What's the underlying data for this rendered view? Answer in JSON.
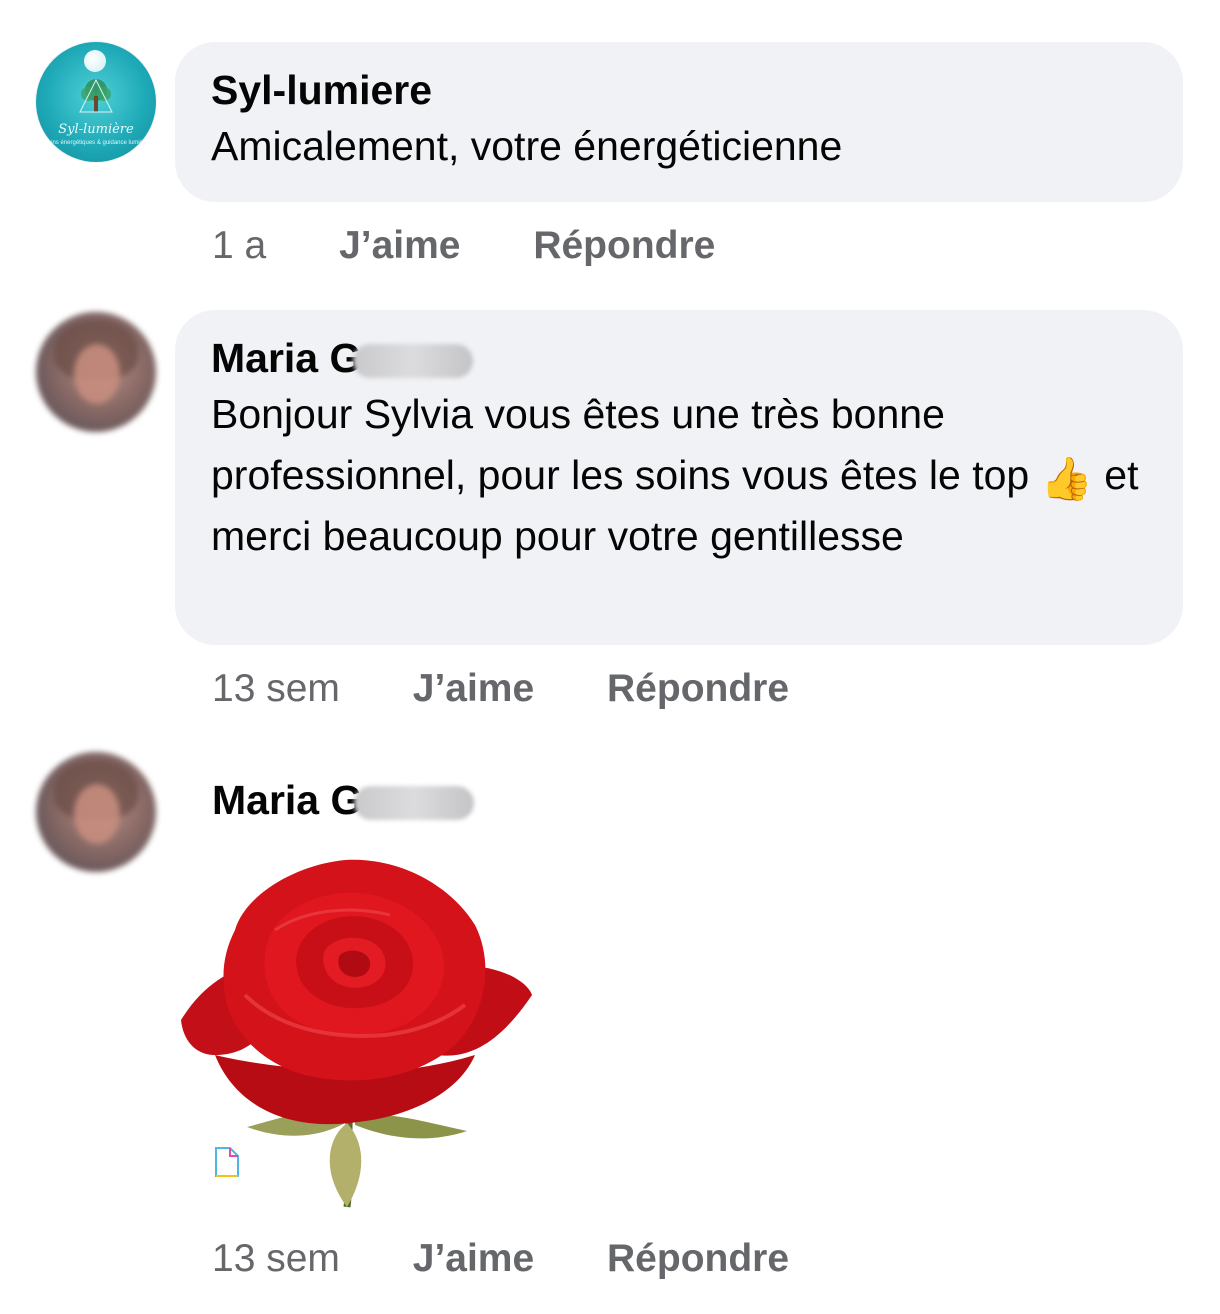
{
  "comments": [
    {
      "author": "Syl-lumiere",
      "text": "Amicalement, votre énergéticienne",
      "time": "1 a",
      "like_label": "J’aime",
      "reply_label": "Répondre",
      "avatar": {
        "type": "logo",
        "brand_text": "Syl-lumière",
        "tagline": "Soins énergétiques & guidance lumière"
      }
    },
    {
      "author": "Maria G",
      "text_before_emoji": "Bonjour Sylvia vous êtes une très bonne professionnel, pour les soins vous êtes le top",
      "emoji": "👍",
      "text_after_emoji": " et merci beaucoup pour votre gentillesse",
      "time": "13 sem",
      "like_label": "J’aime",
      "reply_label": "Répondre",
      "avatar": {
        "type": "photo-blurred"
      }
    },
    {
      "author": "Maria G",
      "sticker": "red-rose",
      "time": "13 sem",
      "like_label": "J’aime",
      "reply_label": "Répondre",
      "avatar": {
        "type": "photo-blurred"
      }
    }
  ],
  "colors": {
    "bubble": "#f0f2f5",
    "text": "#050505",
    "meta": "#65676b",
    "rose": "#d3121a",
    "logo_teal": "#1faab8"
  }
}
